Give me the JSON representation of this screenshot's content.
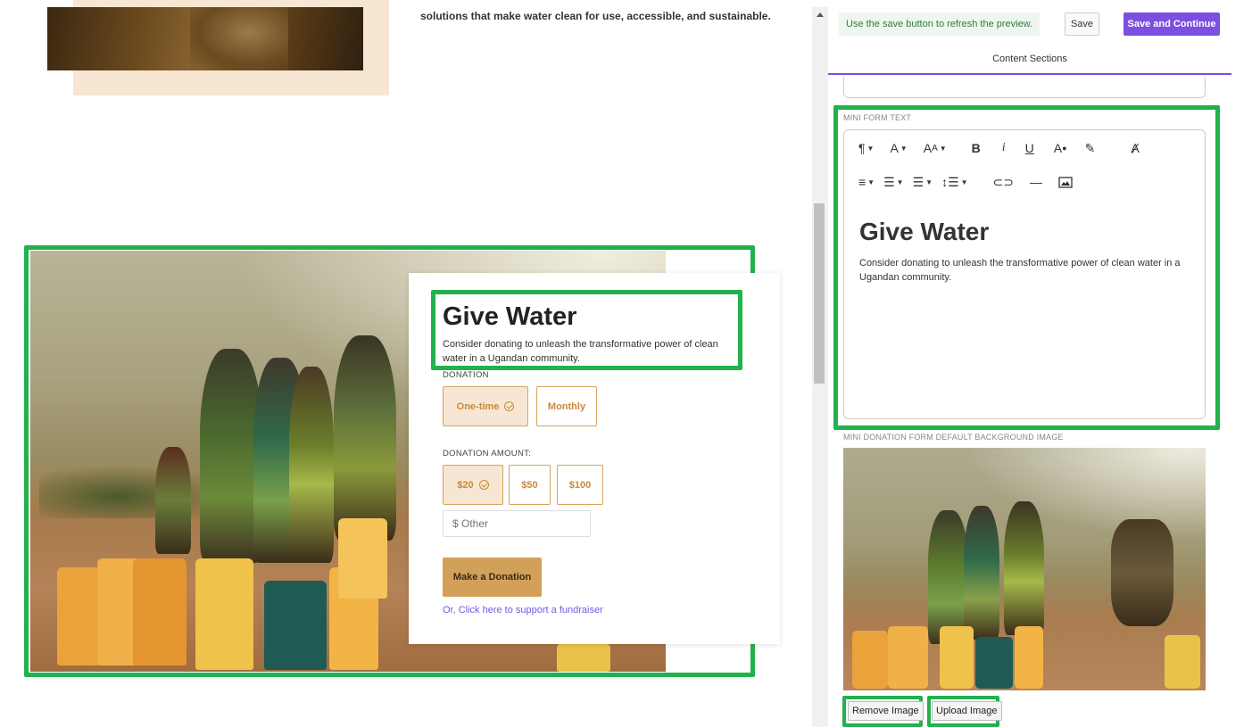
{
  "preview": {
    "top_text": "solutions that make water clean for use, accessible, and sustainable.",
    "form": {
      "title": "Give Water",
      "description": "Consider donating to unleash the transformative power of clean water in a Ugandan community.",
      "donation_label": "DONATION",
      "frequency_options": [
        {
          "label": "One-time",
          "selected": true
        },
        {
          "label": "Monthly",
          "selected": false
        }
      ],
      "amount_label": "DONATION AMOUNT:",
      "amount_options": [
        {
          "label": "$20",
          "selected": true
        },
        {
          "label": "$50",
          "selected": false
        },
        {
          "label": "$100",
          "selected": false
        }
      ],
      "other_placeholder": "$ Other",
      "donate_button": "Make a Donation",
      "fundraiser_link": "Or, Click here to support a fundraiser"
    }
  },
  "editor": {
    "hint": "Use the save button to refresh the preview.",
    "save_label": "Save",
    "save_continue_label": "Save and Continue",
    "tab_label": "Content Sections",
    "mini_form_label": "MINI FORM TEXT",
    "rte": {
      "title": "Give Water",
      "body": "Consider donating to unleash the transformative power of clean water in a Ugandan community.",
      "toolbar_row1": [
        "paragraph-icon",
        "font-icon",
        "font-size-icon",
        "bold-icon",
        "italic-icon",
        "underline-icon",
        "text-color-icon",
        "highlight-icon",
        "clear-format-icon"
      ],
      "toolbar_row2": [
        "align-icon",
        "ordered-list-icon",
        "unordered-list-icon",
        "line-height-icon",
        "link-icon",
        "horizontal-rule-icon",
        "image-icon"
      ]
    },
    "bg_image_label": "MINI DONATION FORM DEFAULT BACKGROUND IMAGE",
    "remove_image_label": "Remove Image",
    "upload_image_label": "Upload Image"
  },
  "colors": {
    "accent_purple": "#7b4fe0",
    "highlight_green": "#22b14c",
    "donate_gold": "#d3a05a",
    "option_border": "#d7a45c"
  }
}
